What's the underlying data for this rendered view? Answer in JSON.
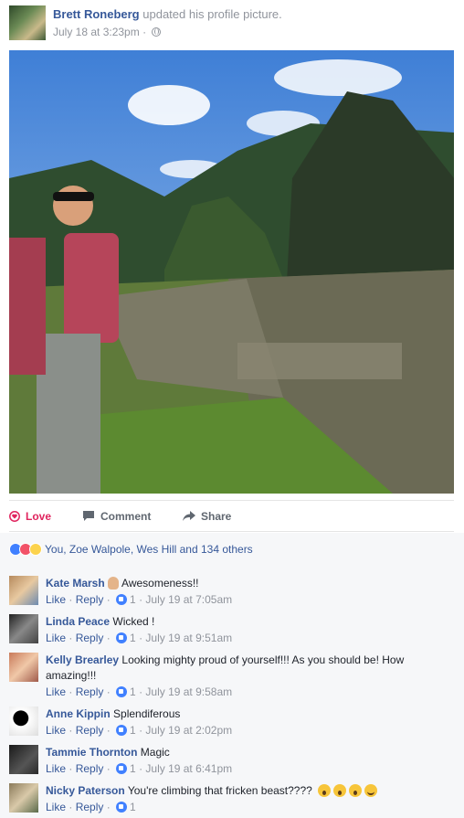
{
  "post": {
    "author": "Brett Roneberg",
    "action": "updated his profile picture.",
    "timestamp": "July 18 at 3:23pm",
    "separator": "·",
    "privacy_icon": "globe-icon"
  },
  "actions": {
    "love": "Love",
    "comment": "Comment",
    "share": "Share"
  },
  "reactions": {
    "icons": [
      "like-icon",
      "love-icon",
      "wow-icon"
    ],
    "summary": "You, Zoe Walpole, Wes Hill and 134 others"
  },
  "comments": [
    {
      "name": "Kate Marsh",
      "text": "Awesomeness!!",
      "prefix_emoji": "ok-hand-icon",
      "like": "Like",
      "reply": "Reply",
      "likes": "1",
      "time": "July 19 at 7:05am"
    },
    {
      "name": "Linda Peace",
      "text": "Wicked !",
      "like": "Like",
      "reply": "Reply",
      "likes": "1",
      "time": "July 19 at 9:51am"
    },
    {
      "name": "Kelly Brearley",
      "text": "Looking mighty proud of yourself!!! As you should be! How amazing!!!",
      "like": "Like",
      "reply": "Reply",
      "likes": "1",
      "time": "July 19 at 9:58am"
    },
    {
      "name": "Anne Kippin",
      "text": "Splendiferous",
      "like": "Like",
      "reply": "Reply",
      "likes": "1",
      "time": "July 19 at 2:02pm"
    },
    {
      "name": "Tammie Thornton",
      "text": "Magic",
      "like": "Like",
      "reply": "Reply",
      "likes": "1",
      "time": "July 19 at 6:41pm"
    },
    {
      "name": "Nicky Paterson",
      "text": "You're climbing that fricken beast????",
      "suffix_emojis": [
        "wow-icon",
        "wow-icon",
        "wow-icon",
        "smile-icon"
      ],
      "like": "Like",
      "reply": "Reply",
      "likes": "1"
    }
  ],
  "colors": {
    "link": "#365899",
    "meta": "#90949c",
    "love": "#e0245e",
    "like_blue": "#4080ff",
    "comments_bg": "#f6f7f9"
  }
}
